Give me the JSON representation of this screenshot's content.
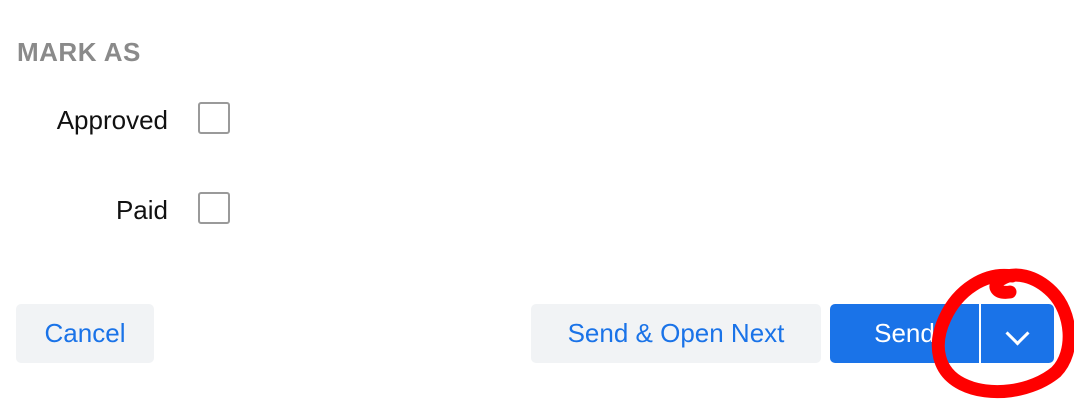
{
  "section": {
    "heading": "MARK AS"
  },
  "checks": [
    {
      "label": "Approved",
      "checked": false
    },
    {
      "label": "Paid",
      "checked": false
    }
  ],
  "buttons": {
    "cancel_label": "Cancel",
    "send_open_next_label": "Send & Open Next",
    "send_label": "Send",
    "send_menu_icon": "chevron-down-icon"
  },
  "colors": {
    "accent": "#1a73e8",
    "secondary_bg": "#f1f3f5",
    "heading": "#8a8a8a",
    "annotation": "#ff0000"
  }
}
